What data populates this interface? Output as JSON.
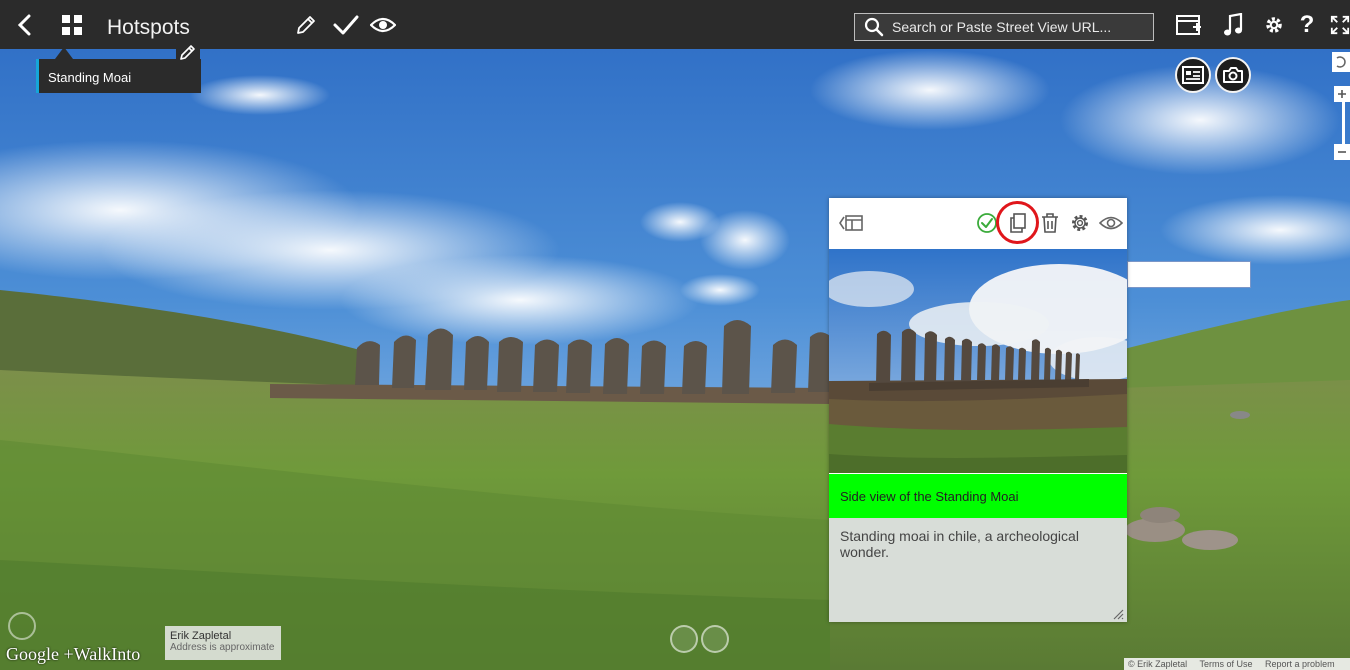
{
  "app": {
    "title": "Hotspots",
    "search_placeholder": "Search or Paste Street View URL...",
    "toolbar_icons": [
      "back-icon",
      "grid-icon",
      "pencil-icon",
      "check-icon",
      "eye-icon",
      "add-panel-icon",
      "music-icon",
      "gear-icon",
      "help-icon",
      "fullscreen-icon"
    ],
    "help_label": "?"
  },
  "hotspot_tooltip": {
    "label": "Standing Moai"
  },
  "round_buttons": [
    "info-card-icon",
    "camera-icon"
  ],
  "card": {
    "toolbar_icons": [
      "collapse-panel-icon",
      "check-circle-icon",
      "copy-icon",
      "trash-icon",
      "gear-icon",
      "eye-icon"
    ],
    "title": "Side view of the Standing Moai",
    "description": "Standing moai in chile, a archeological wonder.",
    "accent_color": "#00ff00",
    "check_color": "#3bab3b",
    "highlight_ring_color": "#e0161b"
  },
  "footer": {
    "brand_google": "Google",
    "brand_sep": "+",
    "brand_walkinto": "WalkInto",
    "author_name": "Erik Zapletal",
    "author_note": "Address is approximate",
    "copyright": "© Erik Zapletal",
    "terms": "Terms of Use",
    "report": "Report a problem"
  },
  "colors": {
    "topbar": "#2b2b2b",
    "tooltip_accent": "#16a6d8",
    "sky": "#3a78c8",
    "grass": "#6b8d3a"
  }
}
